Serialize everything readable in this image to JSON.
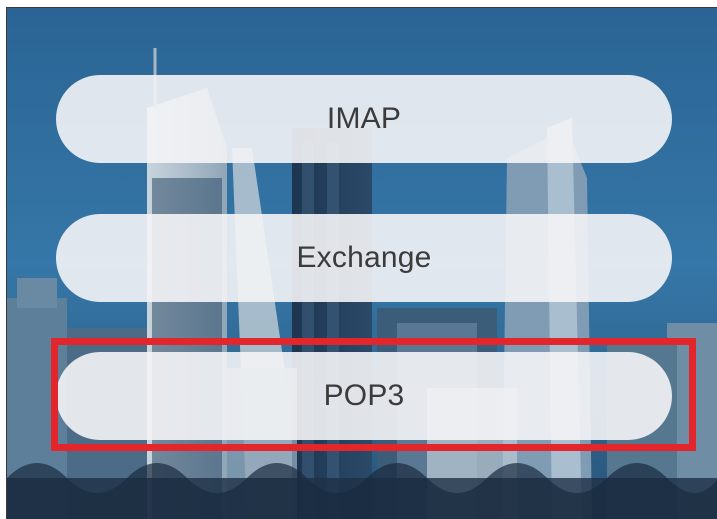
{
  "account_types": {
    "imap_label": "IMAP",
    "exchange_label": "Exchange",
    "pop3_label": "POP3"
  },
  "highlighted_option": "POP3",
  "colors": {
    "highlight_border": "#e2262c",
    "button_fill": "#f4f4f6",
    "button_text": "#3b3b3b",
    "background_sky": "#2d6c9c"
  }
}
